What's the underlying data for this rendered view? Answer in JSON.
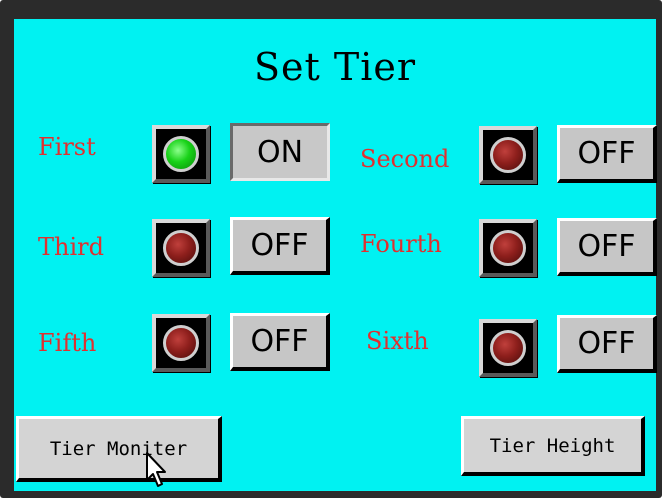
{
  "title": "Set Tier",
  "tiers": [
    {
      "label": "First",
      "state": "ON"
    },
    {
      "label": "Second",
      "state": "OFF"
    },
    {
      "label": "Third",
      "state": "OFF"
    },
    {
      "label": "Fourth",
      "state": "OFF"
    },
    {
      "label": "Fifth",
      "state": "OFF"
    },
    {
      "label": "Sixth",
      "state": "OFF"
    }
  ],
  "buttons": {
    "tier_monitor": "Tier Moniter",
    "tier_height": "Tier Height"
  },
  "colors": {
    "screen_background": "#00f2f2",
    "label_text": "#e03030",
    "lamp_on": "#18d218",
    "lamp_off": "#8e1f1c",
    "button_face": "#c6c6c6"
  },
  "icons": {
    "lamp": "indicator-lamp-icon",
    "pointer": "mouse-pointer-icon"
  }
}
